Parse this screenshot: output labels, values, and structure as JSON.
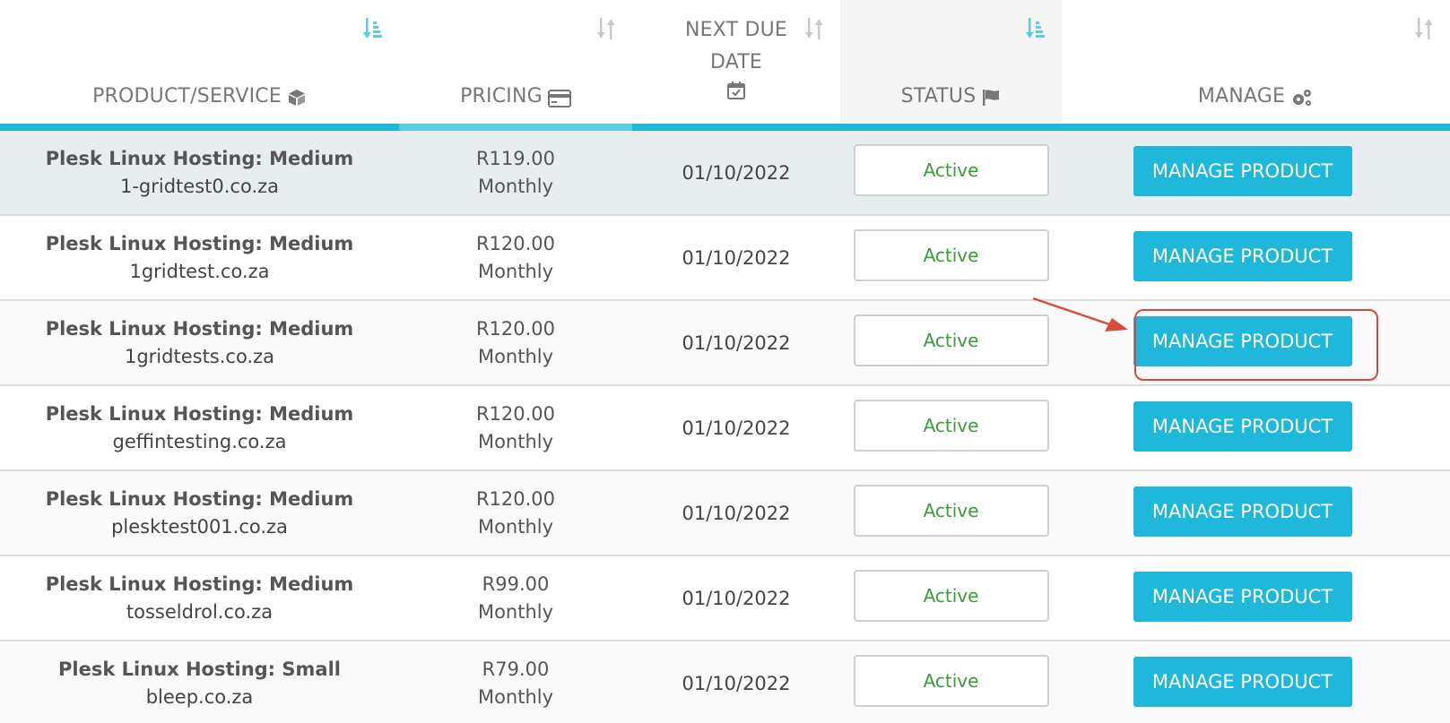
{
  "headers": {
    "product": "PRODUCT/SERVICE",
    "pricing": "PRICING",
    "due_line1": "NEXT DUE",
    "due_line2": "DATE",
    "status": "STATUS",
    "manage": "MANAGE"
  },
  "icons": {
    "product": "box-icon",
    "pricing": "credit-card-icon",
    "due": "calendar-check-icon",
    "status": "flag-icon",
    "manage": "cogs-icon",
    "sort_active": "sort-amount-icon",
    "sort_inactive": "sort-icon"
  },
  "colors": {
    "accent": "#1fb8da",
    "active_text": "#3c9b3c",
    "highlight": "#d9493c"
  },
  "rows": [
    {
      "name": "Plesk Linux Hosting: Medium",
      "domain": "1-gridtest0.co.za",
      "price": "R119.00",
      "cycle": "Monthly",
      "due": "01/10/2022",
      "status": "Active",
      "action": "MANAGE PRODUCT"
    },
    {
      "name": "Plesk Linux Hosting: Medium",
      "domain": "1gridtest.co.za",
      "price": "R120.00",
      "cycle": "Monthly",
      "due": "01/10/2022",
      "status": "Active",
      "action": "MANAGE PRODUCT"
    },
    {
      "name": "Plesk Linux Hosting: Medium",
      "domain": "1gridtests.co.za",
      "price": "R120.00",
      "cycle": "Monthly",
      "due": "01/10/2022",
      "status": "Active",
      "action": "MANAGE PRODUCT"
    },
    {
      "name": "Plesk Linux Hosting: Medium",
      "domain": "geffintesting.co.za",
      "price": "R120.00",
      "cycle": "Monthly",
      "due": "01/10/2022",
      "status": "Active",
      "action": "MANAGE PRODUCT"
    },
    {
      "name": "Plesk Linux Hosting: Medium",
      "domain": "plesktest001.co.za",
      "price": "R120.00",
      "cycle": "Monthly",
      "due": "01/10/2022",
      "status": "Active",
      "action": "MANAGE PRODUCT"
    },
    {
      "name": "Plesk Linux Hosting: Medium",
      "domain": "tosseldrol.co.za",
      "price": "R99.00",
      "cycle": "Monthly",
      "due": "01/10/2022",
      "status": "Active",
      "action": "MANAGE PRODUCT"
    },
    {
      "name": "Plesk Linux Hosting: Small",
      "domain": "bleep.co.za",
      "price": "R79.00",
      "cycle": "Monthly",
      "due": "01/10/2022",
      "status": "Active",
      "action": "MANAGE PRODUCT"
    }
  ]
}
